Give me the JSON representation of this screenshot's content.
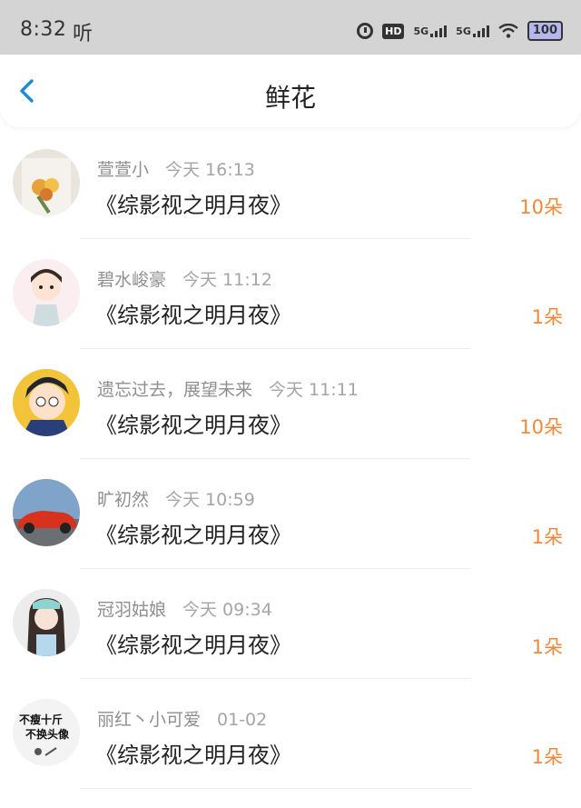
{
  "status_bar": {
    "time": "8:32",
    "note_icon_glyph": "听",
    "hd_label": "HD",
    "network1": "5G",
    "network2": "5G",
    "battery": "100"
  },
  "header": {
    "title": "鲜花",
    "back_icon": "chevron-left-icon"
  },
  "colors": {
    "accent": "#1a8bd6",
    "count": "#f0883a",
    "meta": "#8f8f8f"
  },
  "items": [
    {
      "name": "萱萱小",
      "time": "今天 16:13",
      "book": "《综影视之明月夜》",
      "count": "10朵"
    },
    {
      "name": "碧水峻豪",
      "time": "今天 11:12",
      "book": "《综影视之明月夜》",
      "count": "1朵"
    },
    {
      "name": "遗忘过去，展望未来",
      "time": "今天 11:11",
      "book": "《综影视之明月夜》",
      "count": "10朵"
    },
    {
      "name": "旷初然",
      "time": "今天 10:59",
      "book": "《综影视之明月夜》",
      "count": "1朵"
    },
    {
      "name": "冠羽姑娘",
      "time": "今天 09:34",
      "book": "《综影视之明月夜》",
      "count": "1朵"
    },
    {
      "name": "丽红丶小可爱",
      "time": "01-02",
      "book": "《综影视之明月夜》",
      "count": "1朵",
      "avatar_text": [
        "不瘦十斤",
        "不换头像"
      ]
    }
  ]
}
